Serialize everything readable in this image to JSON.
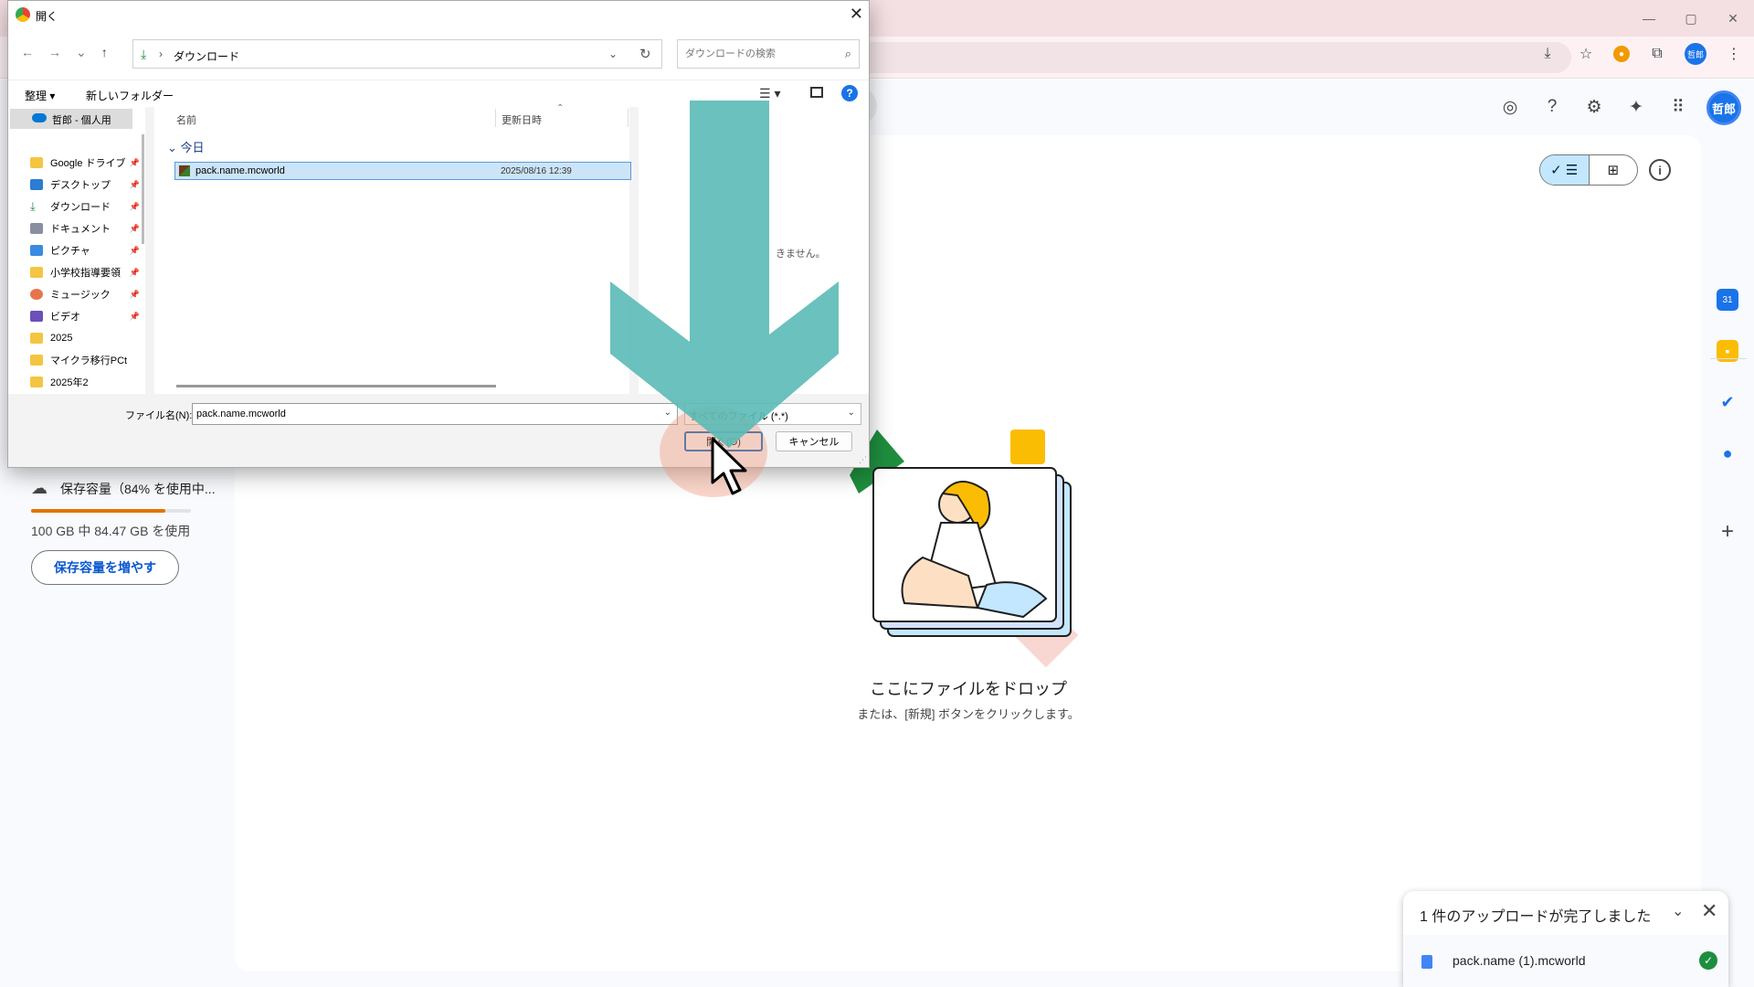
{
  "browser": {
    "window_controls": [
      "—",
      "▢",
      "✕"
    ],
    "toolbar_icons": [
      "download-icon",
      "star-icon",
      "extension-orange-icon",
      "puzzle-icon",
      "profile-avatar",
      "menu-icon"
    ],
    "profile_initials": "哲郎"
  },
  "drive": {
    "account_initials": "哲郎",
    "header_icons": [
      "offline-ready-icon",
      "help-icon",
      "settings-icon",
      "gemini-icon",
      "apps-grid-icon"
    ],
    "storage": {
      "title": "保存容量（84% を使用中...",
      "used_fraction": 0.84,
      "detail": "100 GB 中 84.47 GB を使用",
      "button": "保存容量を増やす"
    },
    "empty_state": {
      "title": "ここにファイルをドロップ",
      "subtitle": "または、[新規] ボタンをクリックします。"
    },
    "upload_panel": {
      "title": "1 件のアップロードが完了しました",
      "file": "pack.name (1).mcworld"
    }
  },
  "dialog": {
    "title": "開く",
    "address": {
      "separator": "›",
      "folder": "ダウンロード"
    },
    "search_placeholder": "ダウンロードの検索",
    "commands": {
      "organize": "整理 ▾",
      "new_folder": "新しいフォルダー"
    },
    "nav": {
      "selected": "哲郎 - 個人用",
      "items": [
        {
          "label": "Google ドライブ",
          "pinned": true
        },
        {
          "label": "デスクトップ",
          "pinned": true
        },
        {
          "label": "ダウンロード",
          "pinned": true
        },
        {
          "label": "ドキュメント",
          "pinned": true
        },
        {
          "label": "ピクチャ",
          "pinned": true
        },
        {
          "label": "小学校指導要領",
          "pinned": true
        },
        {
          "label": "ミュージック",
          "pinned": true
        },
        {
          "label": "ビデオ",
          "pinned": true
        },
        {
          "label": "2025",
          "pinned": false
        },
        {
          "label": "マイクラ移行PCtoiPad",
          "pinned": false
        },
        {
          "label": "2025年2",
          "pinned": false
        }
      ]
    },
    "columns": {
      "name": "名前",
      "date": "更新日時"
    },
    "group": "今日",
    "files": [
      {
        "name": "pack.name.mcworld",
        "date": "2025/08/16 12:39"
      }
    ],
    "preview_text": "きません。",
    "filename_label": "ファイル名(N):",
    "filename_value": "pack.name.mcworld",
    "filetype": "すべてのファイル (*.*)",
    "open_button": "開く(O)",
    "cancel_button": "キャンセル"
  }
}
